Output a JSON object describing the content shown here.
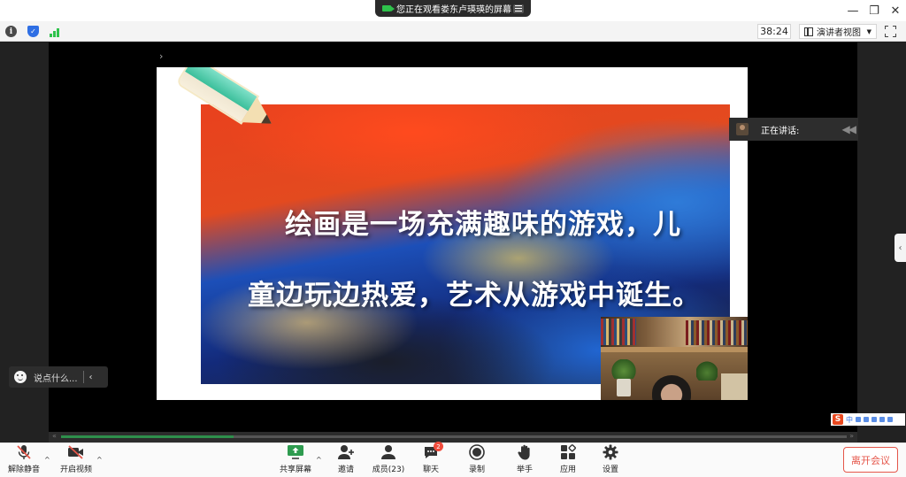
{
  "share_banner": {
    "text": "您正在观看娄东卢瑛瑛的屏幕"
  },
  "window_controls": {
    "minimize": "—",
    "restore": "❐",
    "close": "✕"
  },
  "info_bar": {
    "timer": "38:24",
    "view_mode": "演讲者视图"
  },
  "slide": {
    "line1": "绘画是一场充满趣味的游戏，儿",
    "line2": "童边玩边热爱，艺术从游戏中诞生。"
  },
  "speaking": {
    "label": "正在讲话:"
  },
  "chat_input": {
    "placeholder": "说点什么..."
  },
  "ime": {
    "brand": "S",
    "mode": "中"
  },
  "progress": {
    "fraction": 0.22
  },
  "toolbar": {
    "unmute": "解除静音",
    "start_video": "开启视频",
    "share_screen": "共享屏幕",
    "invite": "邀请",
    "members": "成员(23)",
    "chat": "聊天",
    "chat_badge": "2",
    "record": "录制",
    "raise_hand": "举手",
    "apps": "应用",
    "settings": "设置",
    "leave": "离开会议"
  },
  "colors": {
    "accent_green": "#2ec24b",
    "leave_red": "#e5564a",
    "shield_blue": "#2f6fe4"
  }
}
